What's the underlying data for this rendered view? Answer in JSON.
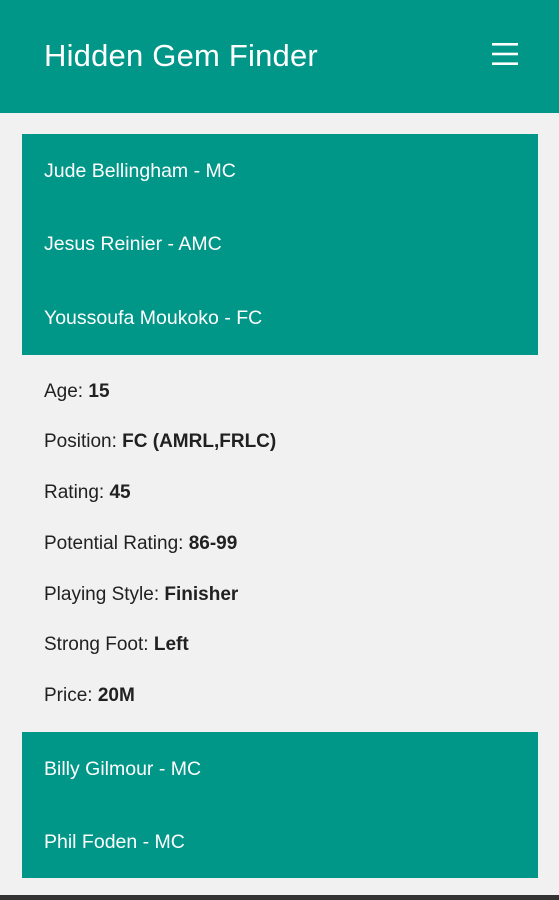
{
  "app": {
    "title": "Hidden Gem Finder",
    "menu_icon": "hamburger-menu-icon",
    "primary_color": "#009688"
  },
  "players_top": [
    {
      "label": "Jude Bellingham - MC"
    },
    {
      "label": "Jesus Reinier - AMC"
    },
    {
      "label": "Youssoufa Moukoko - FC"
    }
  ],
  "details": {
    "age": {
      "label": "Age: ",
      "value": "15"
    },
    "position": {
      "label": "Position: ",
      "value": "FC (AMRL,FRLC)"
    },
    "rating": {
      "label": "Rating: ",
      "value": "45"
    },
    "potential": {
      "label": "Potential Rating: ",
      "value": "86-99"
    },
    "style": {
      "label": "Playing Style: ",
      "value": "Finisher"
    },
    "foot": {
      "label": "Strong Foot: ",
      "value": "Left"
    },
    "price": {
      "label": "Price: ",
      "value": "20M"
    }
  },
  "players_bottom": [
    {
      "label": "Billy Gilmour - MC"
    },
    {
      "label": "Phil Foden - MC"
    }
  ]
}
